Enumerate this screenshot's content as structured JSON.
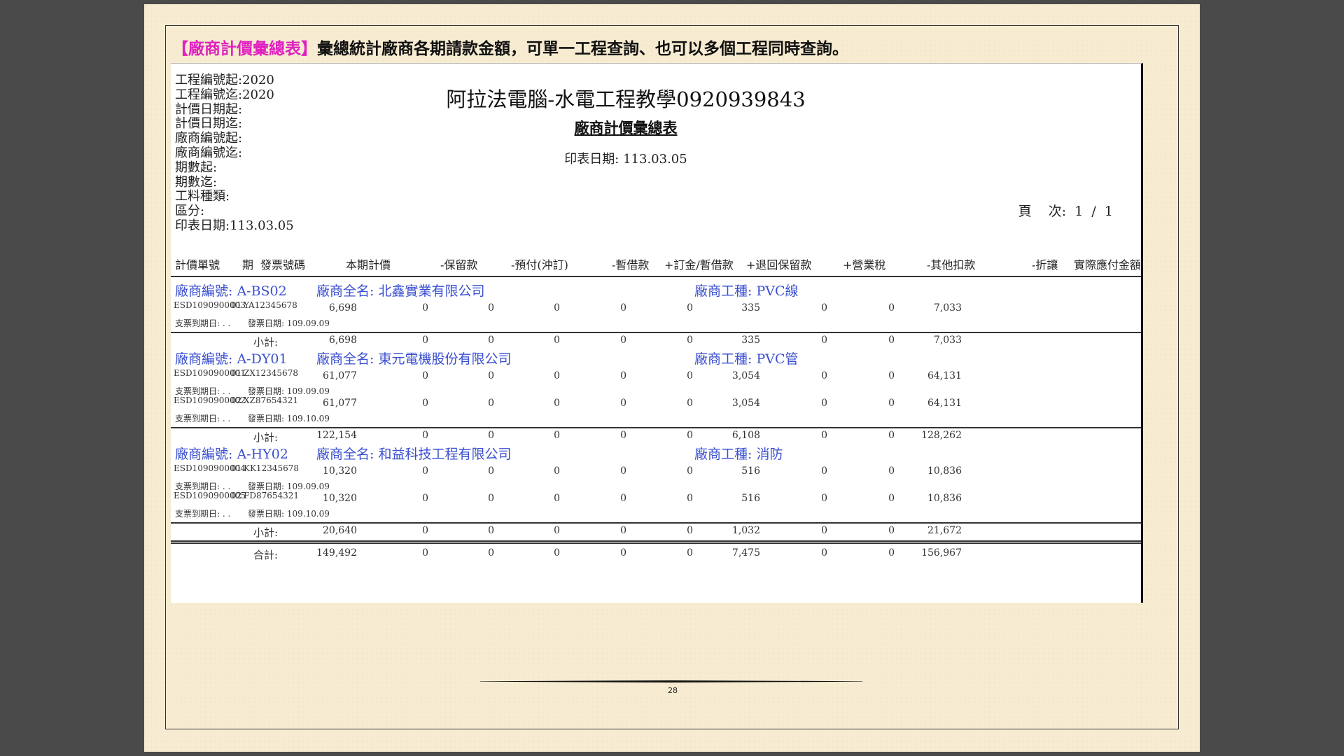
{
  "heading": {
    "tag": "【廠商計價彙總表】",
    "text": "彙總統計廠商各期請款金額，可單一工程查詢、也可以多個工程同時查詢。"
  },
  "report": {
    "filters": [
      "工程編號起:2020",
      "工程編號迄:2020",
      "計價日期起:",
      "計價日期迄:",
      "廠商編號起:",
      "廠商編號迄:",
      "期數起:",
      "期數迄:",
      "工料種類:",
      "區分:",
      "印表日期:113.03.05"
    ],
    "title": "阿拉法電腦-水電工程教學0920939843",
    "subtitle": "廠商計價彙總表",
    "print_date": "印表日期: 113.03.05",
    "page_info": "頁    次:  1  /  1",
    "columns": [
      "計價單號",
      "期",
      "發票號碼",
      "本期計價",
      "-保留款",
      "-預付(沖訂)",
      "-暫借款",
      "+訂金/暫借款",
      "+退回保留款",
      "+營業稅",
      "-其他扣款",
      "-折讓",
      "實際應付金額"
    ],
    "vendors": [
      {
        "code": "廠商編號: A-BS02",
        "name": "廠商全名: 北鑫實業有限公司",
        "trade": "廠商工種: PVC線",
        "rows": [
          {
            "doc": "ESD1090900003",
            "period": "01",
            "invoice": "YA12345678",
            "cheque": "支票到期日:   .  .",
            "inv_date": "發票日期: 109.09.09",
            "values": [
              "6,698",
              "0",
              "0",
              "0",
              "0",
              "0",
              "335",
              "0",
              "0",
              "7,033"
            ]
          }
        ],
        "subtotal": [
          "6,698",
          "0",
          "0",
          "0",
          "0",
          "0",
          "335",
          "0",
          "0",
          "7,033"
        ]
      },
      {
        "code": "廠商編號: A-DY01",
        "name": "廠商全名: 東元電機股份有限公司",
        "trade": "廠商工種: PVC管",
        "rows": [
          {
            "doc": "ESD1090900001",
            "period": "01",
            "invoice": "ZX12345678",
            "cheque": "支票到期日:   .  .",
            "inv_date": "發票日期: 109.09.09",
            "values": [
              "61,077",
              "0",
              "0",
              "0",
              "0",
              "0",
              "3,054",
              "0",
              "0",
              "64,131"
            ]
          },
          {
            "doc": "ESD1090900002",
            "period": "02",
            "invoice": "XZ87654321",
            "cheque": "支票到期日:   .  .",
            "inv_date": "發票日期: 109.10.09",
            "values": [
              "61,077",
              "0",
              "0",
              "0",
              "0",
              "0",
              "3,054",
              "0",
              "0",
              "64,131"
            ]
          }
        ],
        "subtotal": [
          "122,154",
          "0",
          "0",
          "0",
          "0",
          "0",
          "6,108",
          "0",
          "0",
          "128,262"
        ]
      },
      {
        "code": "廠商編號: A-HY02",
        "name": "廠商全名: 和益科技工程有限公司",
        "trade": "廠商工種: 消防",
        "rows": [
          {
            "doc": "ESD1090900004",
            "period": "01",
            "invoice": "KK12345678",
            "cheque": "支票到期日:   .  .",
            "inv_date": "發票日期: 109.09.09",
            "values": [
              "10,320",
              "0",
              "0",
              "0",
              "0",
              "0",
              "516",
              "0",
              "0",
              "10,836"
            ]
          },
          {
            "doc": "ESD1090900005",
            "period": "02",
            "invoice": "FD87654321",
            "cheque": "支票到期日:   .  .",
            "inv_date": "發票日期: 109.10.09",
            "values": [
              "10,320",
              "0",
              "0",
              "0",
              "0",
              "0",
              "516",
              "0",
              "0",
              "10,836"
            ]
          }
        ],
        "subtotal": [
          "20,640",
          "0",
          "0",
          "0",
          "0",
          "0",
          "1,032",
          "0",
          "0",
          "21,672"
        ]
      }
    ],
    "subtotal_label": "小計:",
    "total_label": "合計:",
    "total": [
      "149,492",
      "0",
      "0",
      "0",
      "0",
      "0",
      "7,475",
      "0",
      "0",
      "156,967"
    ]
  },
  "page_number": "28"
}
